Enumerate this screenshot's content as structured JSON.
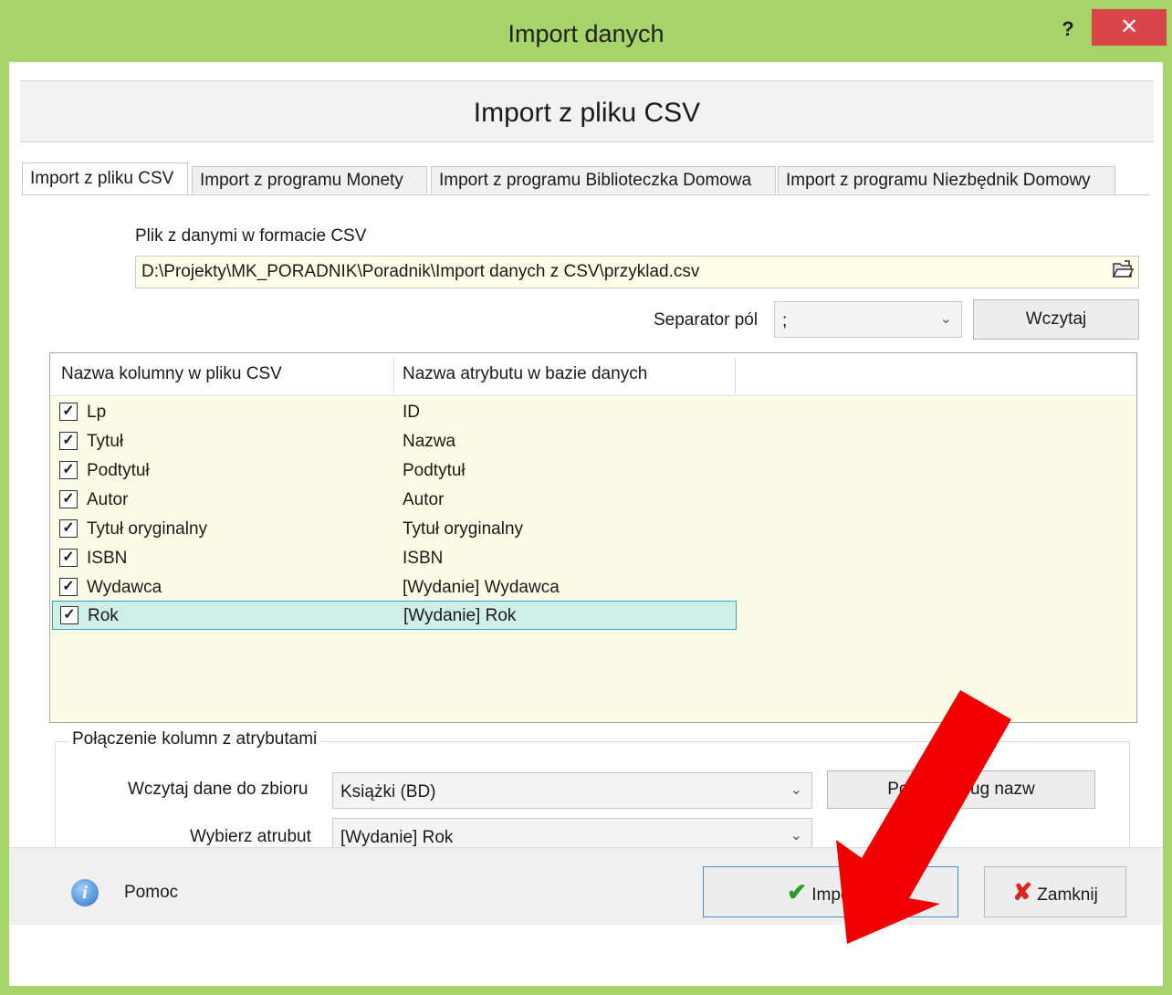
{
  "window": {
    "title": "Import danych",
    "help_label": "?",
    "close_label": "✕"
  },
  "banner": {
    "title": "Import z pliku CSV"
  },
  "tabs": [
    {
      "label": "Import z pliku CSV",
      "active": true
    },
    {
      "label": "Import z programu Monety",
      "active": false
    },
    {
      "label": "Import z programu Biblioteczka Domowa",
      "active": false
    },
    {
      "label": "Import z programu Niezbędnik Domowy",
      "active": false
    }
  ],
  "file": {
    "label": "Plik z danymi w formacie CSV",
    "value": "D:\\Projekty\\MK_PORADNIK\\Poradnik\\Import danych z CSV\\przyklad.csv",
    "browse_icon": "open-folder-icon"
  },
  "separator": {
    "label": "Separator pól",
    "value": ";",
    "load_button": "Wczytaj"
  },
  "grid": {
    "headers": [
      "Nazwa kolumny w pliku CSV",
      "Nazwa atrybutu w bazie danych"
    ],
    "rows": [
      {
        "checked": true,
        "column": "Lp",
        "attribute": "ID"
      },
      {
        "checked": true,
        "column": "Tytuł",
        "attribute": "Nazwa"
      },
      {
        "checked": true,
        "column": "Podtytuł",
        "attribute": "Podtytuł"
      },
      {
        "checked": true,
        "column": "Autor",
        "attribute": "Autor"
      },
      {
        "checked": true,
        "column": "Tytuł oryginalny",
        "attribute": "Tytuł oryginalny"
      },
      {
        "checked": true,
        "column": "ISBN",
        "attribute": "ISBN"
      },
      {
        "checked": true,
        "column": "Wydawca",
        "attribute": "[Wydanie] Wydawca"
      },
      {
        "checked": true,
        "column": "Rok",
        "attribute": "[Wydanie] Rok",
        "selected": true
      }
    ]
  },
  "mapping": {
    "group_title": "Połączenie kolumn z atrybutami",
    "dataset_label": "Wczytaj dane do zbioru",
    "dataset_value": "Książki (BD)",
    "attribute_label": "Wybierz atrubut",
    "attribute_value": "[Wydanie] Rok",
    "match_button": "Poł            ug nazw"
  },
  "footer": {
    "help_label": "Pomoc",
    "import_button": "Importuj",
    "close_button": "Zamknij"
  },
  "colors": {
    "frame": "#a6d36a",
    "close": "#d9464a",
    "grid_bg": "#fbfbe6",
    "selected_row": "#cfeee6",
    "arrow": "#f00000"
  }
}
